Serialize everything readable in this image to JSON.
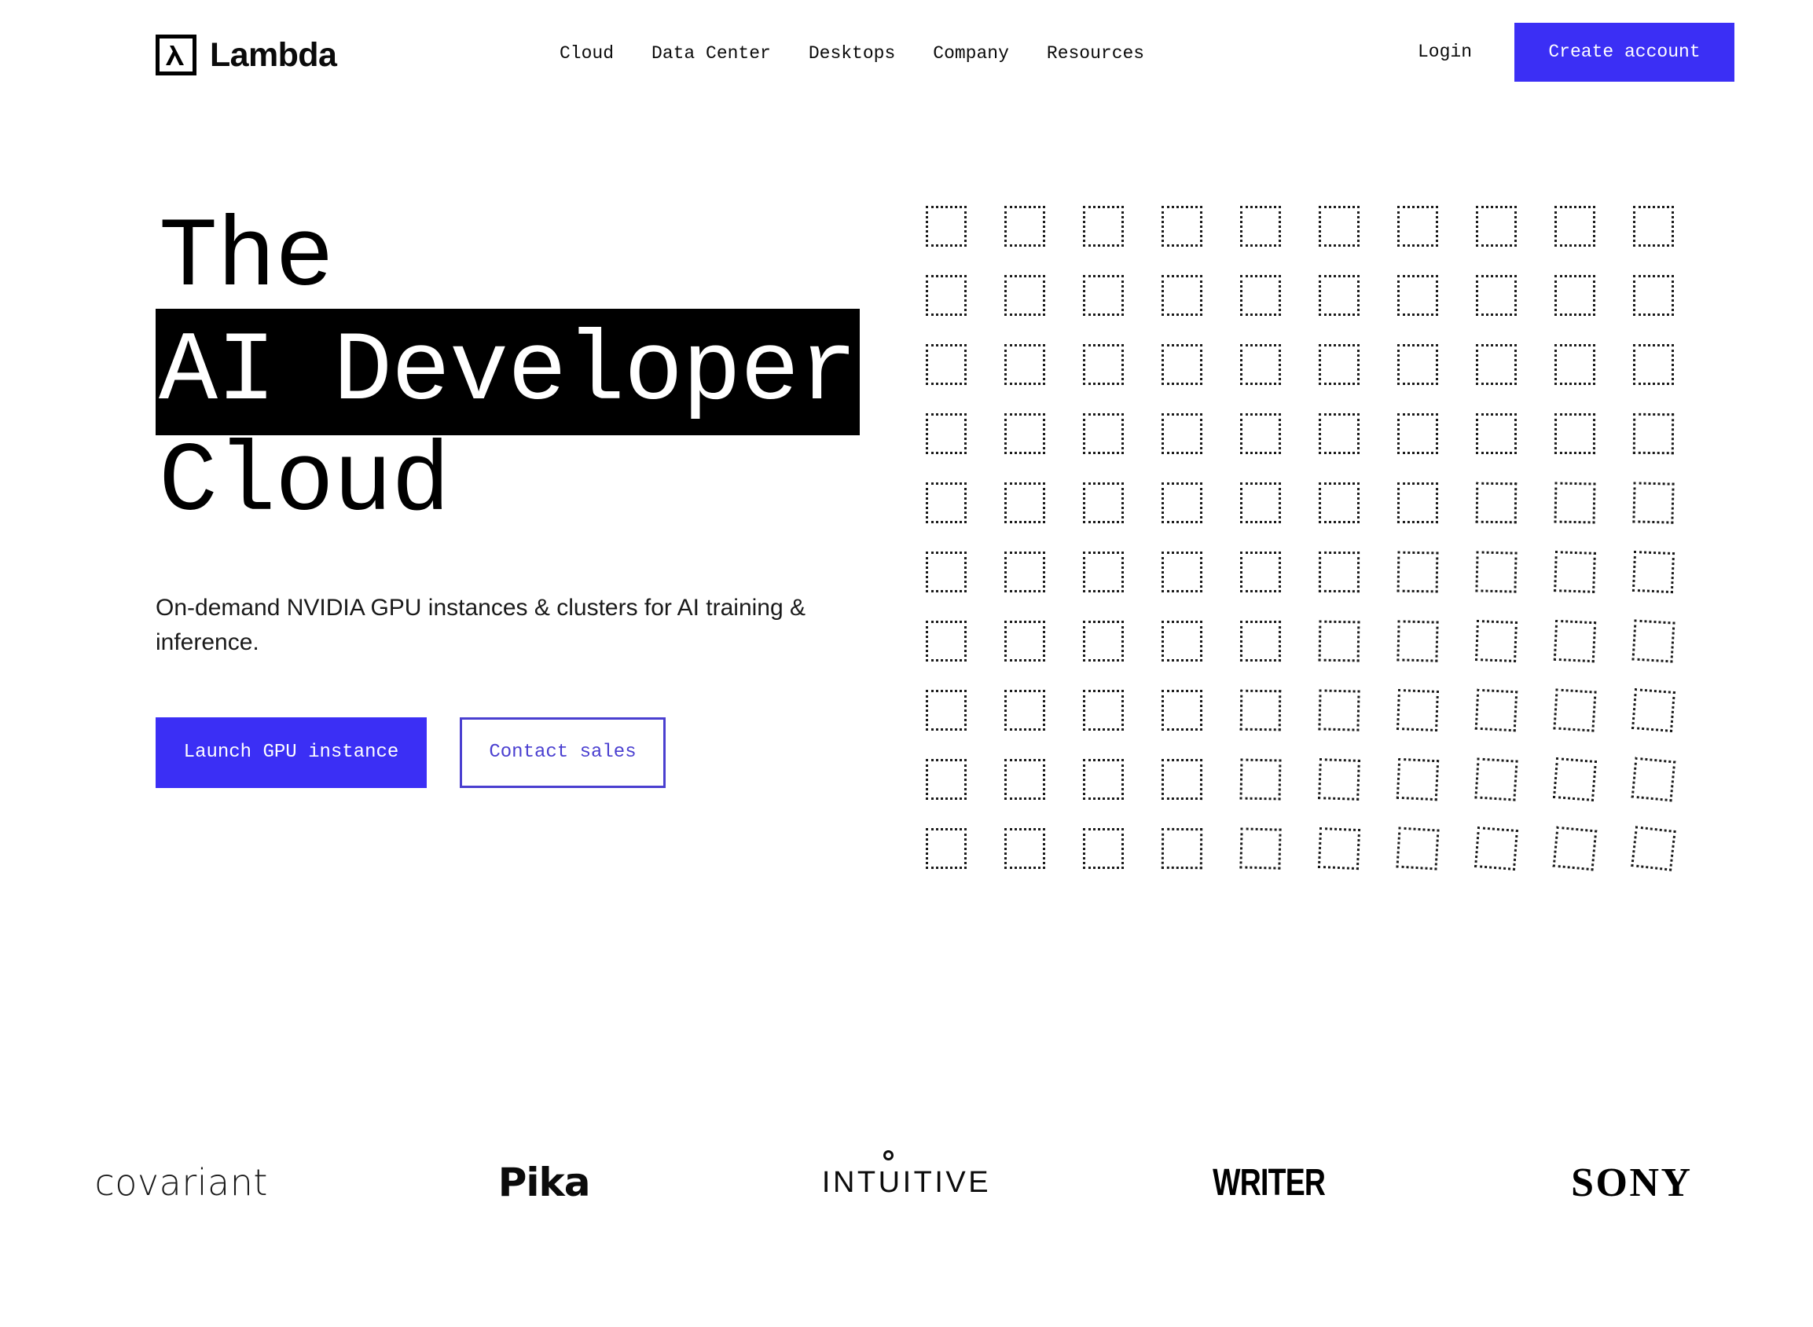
{
  "brand": {
    "name": "Lambda",
    "mark_icon": "lambda-square-icon",
    "mark_glyph": "λ"
  },
  "nav": {
    "items": [
      {
        "label": "Cloud"
      },
      {
        "label": "Data Center"
      },
      {
        "label": "Desktops"
      },
      {
        "label": "Company"
      },
      {
        "label": "Resources"
      }
    ],
    "login_label": "Login",
    "create_account_label": "Create account"
  },
  "hero": {
    "headline_line1": "The",
    "headline_line2": "AI Developer",
    "headline_line3": "Cloud",
    "subtitle": "On-demand NVIDIA GPU instances & clusters for AI training & inference.",
    "primary_cta": "Launch GPU instance",
    "secondary_cta": "Contact sales"
  },
  "grid_art": {
    "icon": "dotted-square-grid",
    "rows": 10,
    "columns": 10,
    "cell_size": 52
  },
  "logos": [
    {
      "name": "covariant",
      "label": "covariant"
    },
    {
      "name": "pika",
      "label": "Pika"
    },
    {
      "name": "intuitive",
      "label": "INTUITIVE"
    },
    {
      "name": "writer",
      "label": "WRITER"
    },
    {
      "name": "sony",
      "label": "SONY"
    }
  ],
  "colors": {
    "accent_blue": "#3b2ff5",
    "outline_blue": "#4a3fd0",
    "ink": "#000000",
    "background": "#ffffff"
  }
}
